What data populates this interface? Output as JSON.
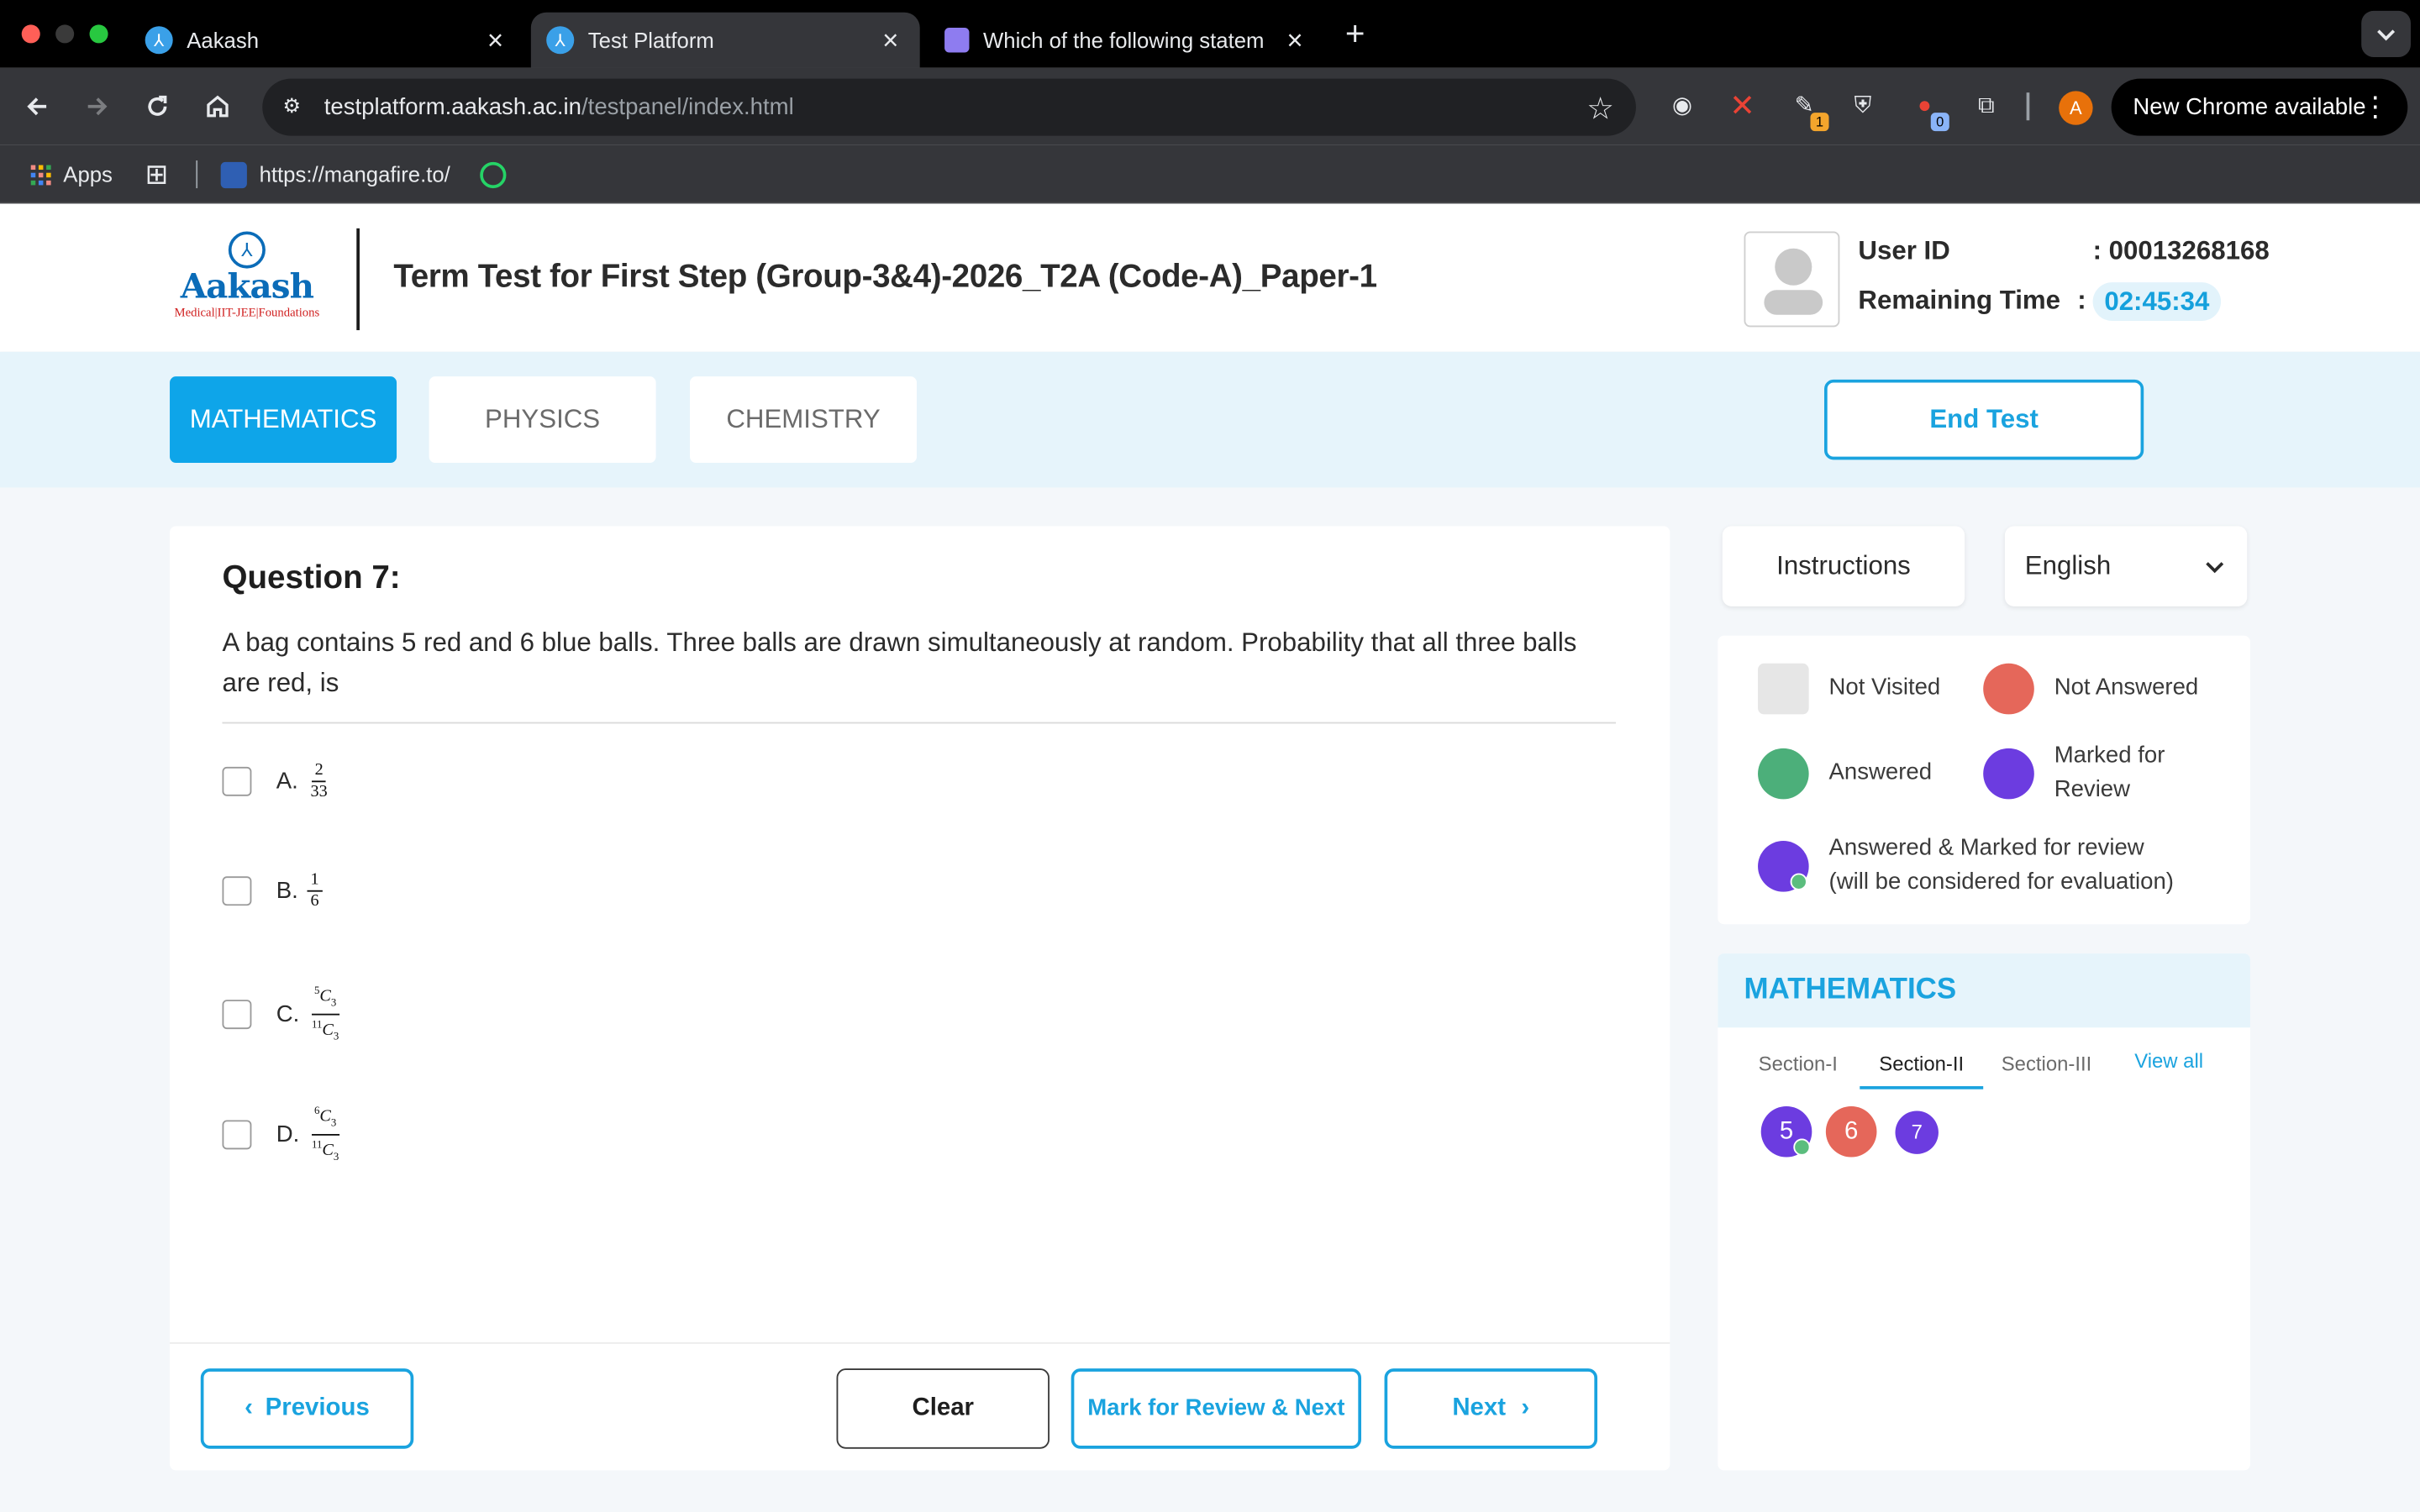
{
  "browser": {
    "tabs": [
      {
        "title": "Aakash",
        "active": false
      },
      {
        "title": "Test Platform",
        "active": true
      },
      {
        "title": "Which of the following statem",
        "active": false
      }
    ],
    "url_host": "testplatform.aakash.ac.in",
    "url_path": "/testpanel/index.html",
    "extension_badges": [
      "1",
      "0"
    ],
    "profile_initial": "A",
    "update_label": "New Chrome available",
    "bookmarks": {
      "apps": "Apps",
      "link": "https://mangafire.to/"
    }
  },
  "header": {
    "logo_word": "Aakash",
    "logo_tagline": "Medical|IIT-JEE|Foundations",
    "test_title": "Term Test for First Step (Group-3&4)-2026_T2A (Code-A)_Paper-1",
    "user_id_label": "User ID",
    "user_id_value": ": 00013268168",
    "remaining_label": "Remaining Time",
    "remaining_colon": ":",
    "remaining_value": "02:45:34"
  },
  "subjects": [
    {
      "label": "MATHEMATICS",
      "active": true
    },
    {
      "label": "PHYSICS",
      "active": false
    },
    {
      "label": "CHEMISTRY",
      "active": false
    }
  ],
  "end_test_label": "End Test",
  "question": {
    "title": "Question 7:",
    "text": "A bag contains 5 red and 6 blue balls. Three balls are drawn simultaneously at random. Probability that all three balls are red, is",
    "options": [
      {
        "letter": "A.",
        "num": "2",
        "den": "33"
      },
      {
        "letter": "B.",
        "num": "1",
        "den": "6"
      },
      {
        "letter": "C.",
        "num_pre": "5",
        "num_main": "C",
        "num_sub": "3",
        "den_pre": "11",
        "den_main": "C",
        "den_sub": "3"
      },
      {
        "letter": "D.",
        "num_pre": "6",
        "num_main": "C",
        "num_sub": "3",
        "den_pre": "11",
        "den_main": "C",
        "den_sub": "3"
      }
    ]
  },
  "buttons": {
    "previous": "Previous",
    "clear": "Clear",
    "mark_review_next": "Mark for Review & Next",
    "next": "Next"
  },
  "side": {
    "instructions": "Instructions",
    "language": "English",
    "legend": {
      "not_visited": "Not Visited",
      "not_answered": "Not Answered",
      "answered": "Answered",
      "marked_line1": "Marked for",
      "marked_line2": "Review",
      "answered_marked_line1": "Answered & Marked for review",
      "answered_marked_line2": "(will be considered for evaluation)"
    },
    "palette_title": "MATHEMATICS",
    "sections": [
      "Section-I",
      "Section-II",
      "Section-III"
    ],
    "active_section": "Section-II",
    "view_all": "View all",
    "questions": [
      {
        "num": "5",
        "status": "answered-marked"
      },
      {
        "num": "6",
        "status": "not-answered"
      },
      {
        "num": "7",
        "status": "marked"
      }
    ]
  },
  "colors": {
    "accent": "#0ea5e9",
    "not_answered": "#e5675a",
    "answered": "#4caf7a",
    "marked": "#6c3ce0",
    "not_visited": "#e6e6e6"
  }
}
